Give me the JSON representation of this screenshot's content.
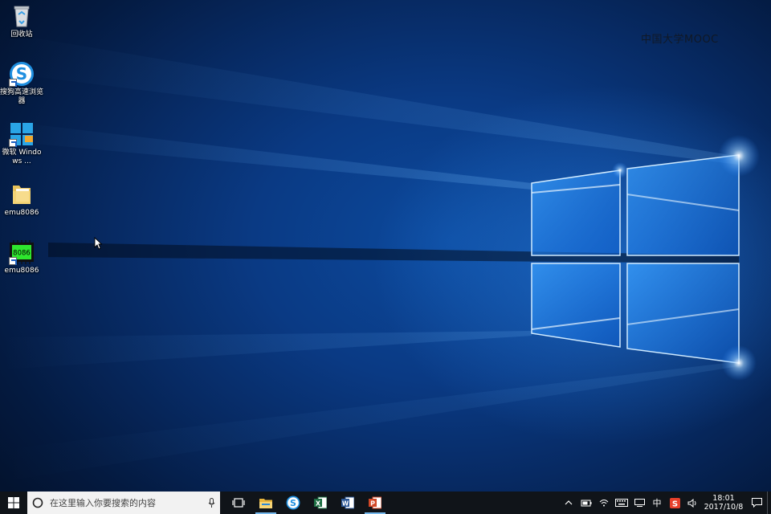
{
  "desktop": {
    "icons": [
      {
        "label": "回收站",
        "icon": "recycle-bin-icon"
      },
      {
        "label": "搜狗高速浏览器",
        "icon": "sogou-browser-icon"
      },
      {
        "label": "微软 Windows ...",
        "icon": "windows-installer-icon"
      },
      {
        "label": "emu8086",
        "icon": "folder-icon"
      },
      {
        "label": "emu8086",
        "icon": "emu8086-chip-icon",
        "chip_text": "8086"
      }
    ],
    "watermark": "中国大学MOOC"
  },
  "taskbar": {
    "search_placeholder": "在这里输入你要搜索的内容",
    "apps": [
      {
        "name": "task-view",
        "icon": "task-view-icon"
      },
      {
        "name": "file-explorer",
        "icon": "file-explorer-icon",
        "active": true
      },
      {
        "name": "sogou-browser",
        "icon": "sogou-browser-icon"
      },
      {
        "name": "excel",
        "icon": "excel-icon",
        "letter": "X"
      },
      {
        "name": "word",
        "icon": "word-icon",
        "letter": "W"
      },
      {
        "name": "powerpoint",
        "icon": "powerpoint-icon",
        "letter": "P",
        "active": true
      }
    ],
    "tray": {
      "ime_label": "中",
      "time": "18:01",
      "date": "2017/10/8"
    }
  },
  "colors": {
    "taskbar": "#101419",
    "accent": "#76b9ed",
    "excel": "#1d7044",
    "word": "#2b5797",
    "powerpoint": "#d24726",
    "chip_green": "#2ee62e"
  }
}
